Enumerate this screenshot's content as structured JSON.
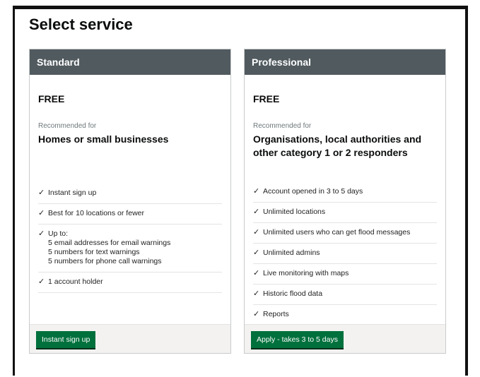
{
  "page": {
    "title": "Select service"
  },
  "standard": {
    "header": "Standard",
    "price": "FREE",
    "recommended_label": "Recommended for",
    "recommended_for": "Homes or small businesses",
    "features": [
      {
        "text": "Instant sign up"
      },
      {
        "text": "Best for 10 locations or fewer"
      },
      {
        "text": "Up to:",
        "sub": [
          "5 email addresses for email warnings",
          "5 numbers for text warnings",
          "5 numbers for phone call warnings"
        ]
      },
      {
        "text": "1 account holder"
      }
    ],
    "button": "Instant sign up"
  },
  "professional": {
    "header": "Professional",
    "price": "FREE",
    "recommended_label": "Recommended for",
    "recommended_for": "Organisations, local authorities and other category 1 or 2 responders",
    "features": [
      {
        "text": "Account opened in 3 to 5 days"
      },
      {
        "text": "Unlimited locations"
      },
      {
        "text": "Unlimited users who can get flood messages"
      },
      {
        "text": "Unlimited admins"
      },
      {
        "text": "Live monitoring with maps"
      },
      {
        "text": "Historic flood data"
      },
      {
        "text": "Reports"
      }
    ],
    "button": "Apply - takes 3 to 5 days"
  },
  "icons": {
    "check": "check-icon"
  },
  "colors": {
    "header_bg": "#505a5f",
    "button_bg": "#00703c",
    "footer_bg": "#f3f2f1"
  }
}
